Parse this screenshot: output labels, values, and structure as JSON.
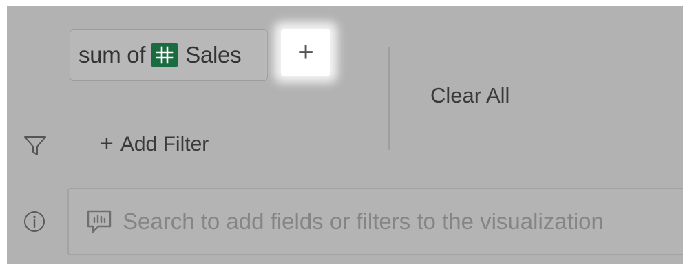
{
  "chip": {
    "prefix": "sum of",
    "field_label": "Sales",
    "field_icon": "number-field-icon",
    "field_icon_color": "#1a6b3f"
  },
  "add_button": {
    "label": "+"
  },
  "clear_all": {
    "label": "Clear All"
  },
  "filter": {
    "icon": "funnel-icon",
    "plus": "+",
    "label": "Add Filter"
  },
  "search": {
    "info_icon": "info-icon",
    "speech_icon": "speech-bubble-icon",
    "placeholder": "Search to add fields or filters to the visualization"
  },
  "colors": {
    "overlay_gray": "#b2b2b2",
    "highlight": "#ffffff",
    "text": "#3a3a3a"
  }
}
